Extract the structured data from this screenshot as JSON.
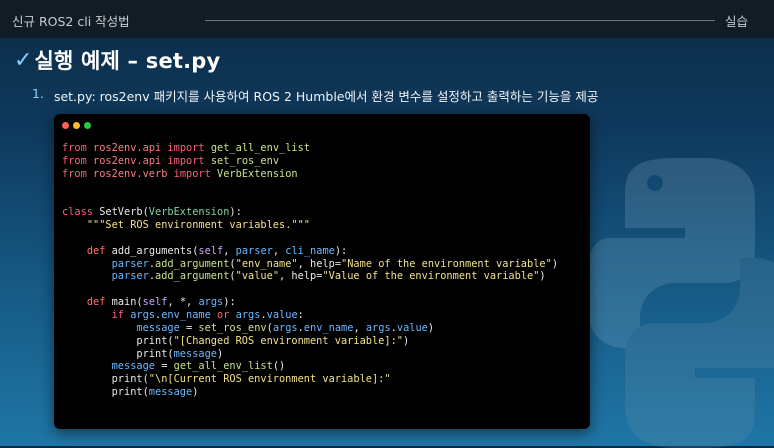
{
  "header": {
    "left_title": "신규 ROS2 cli 작성법",
    "right_tag": "실습"
  },
  "slide": {
    "title": "실행 예제 – set.py",
    "item_number": "1.",
    "item_text": "set.py: ros2env 패키지를 사용하여 ROS 2 Humble에서 환경 변수를 설정하고 출력하는 기능을 제공"
  },
  "code": {
    "lines": [
      [
        [
          "kw",
          "from"
        ],
        [
          "plain",
          " "
        ],
        [
          "mod",
          "ros2env.api"
        ],
        [
          "plain",
          " "
        ],
        [
          "kw",
          "import"
        ],
        [
          "plain",
          " "
        ],
        [
          "fnname",
          "get_all_env_list"
        ]
      ],
      [
        [
          "kw",
          "from"
        ],
        [
          "plain",
          " "
        ],
        [
          "mod",
          "ros2env.api"
        ],
        [
          "plain",
          " "
        ],
        [
          "kw",
          "import"
        ],
        [
          "plain",
          " "
        ],
        [
          "fnname",
          "set_ros_env"
        ]
      ],
      [
        [
          "kw",
          "from"
        ],
        [
          "plain",
          " "
        ],
        [
          "mod",
          "ros2env.verb"
        ],
        [
          "plain",
          " "
        ],
        [
          "kw",
          "import"
        ],
        [
          "plain",
          " "
        ],
        [
          "fnname",
          "VerbExtension"
        ]
      ],
      [
        [
          "plain",
          ""
        ]
      ],
      [
        [
          "plain",
          ""
        ]
      ],
      [
        [
          "kw",
          "class"
        ],
        [
          "plain",
          " SetVerb("
        ],
        [
          "cls",
          "VerbExtension"
        ],
        [
          "plain",
          "):"
        ]
      ],
      [
        [
          "plain",
          "    "
        ],
        [
          "str",
          "\"\"\"Set ROS environment variables.\"\"\""
        ]
      ],
      [
        [
          "plain",
          ""
        ]
      ],
      [
        [
          "plain",
          "    "
        ],
        [
          "def",
          "def"
        ],
        [
          "plain",
          " add_arguments("
        ],
        [
          "self",
          "self"
        ],
        [
          "plain",
          ", "
        ],
        [
          "param",
          "parser"
        ],
        [
          "plain",
          ", "
        ],
        [
          "param",
          "cli_name"
        ],
        [
          "plain",
          "):"
        ]
      ],
      [
        [
          "plain",
          "        "
        ],
        [
          "param",
          "parser"
        ],
        [
          "plain",
          "."
        ],
        [
          "fnname",
          "add_argument"
        ],
        [
          "plain",
          "("
        ],
        [
          "str",
          "\"env_name\""
        ],
        [
          "plain",
          ", help="
        ],
        [
          "str",
          "\"Name of the environment variable\""
        ],
        [
          "plain",
          ")"
        ]
      ],
      [
        [
          "plain",
          "        "
        ],
        [
          "param",
          "parser"
        ],
        [
          "plain",
          "."
        ],
        [
          "fnname",
          "add_argument"
        ],
        [
          "plain",
          "("
        ],
        [
          "str",
          "\"value\""
        ],
        [
          "plain",
          ", help="
        ],
        [
          "str",
          "\"Value of the environment variable\""
        ],
        [
          "plain",
          ")"
        ]
      ],
      [
        [
          "plain",
          ""
        ]
      ],
      [
        [
          "plain",
          "    "
        ],
        [
          "def",
          "def"
        ],
        [
          "plain",
          " main("
        ],
        [
          "self",
          "self"
        ],
        [
          "plain",
          ", *, "
        ],
        [
          "param",
          "args"
        ],
        [
          "plain",
          "):"
        ]
      ],
      [
        [
          "plain",
          "        "
        ],
        [
          "kw",
          "if"
        ],
        [
          "plain",
          " "
        ],
        [
          "param",
          "args"
        ],
        [
          "plain",
          "."
        ],
        [
          "param",
          "env_name"
        ],
        [
          "plain",
          " "
        ],
        [
          "kw",
          "or"
        ],
        [
          "plain",
          " "
        ],
        [
          "param",
          "args"
        ],
        [
          "plain",
          "."
        ],
        [
          "param",
          "value"
        ],
        [
          "plain",
          ":"
        ]
      ],
      [
        [
          "plain",
          "            "
        ],
        [
          "param",
          "message"
        ],
        [
          "plain",
          " = "
        ],
        [
          "fnname",
          "set_ros_env"
        ],
        [
          "plain",
          "("
        ],
        [
          "param",
          "args"
        ],
        [
          "plain",
          "."
        ],
        [
          "param",
          "env_name"
        ],
        [
          "plain",
          ", "
        ],
        [
          "param",
          "args"
        ],
        [
          "plain",
          "."
        ],
        [
          "param",
          "value"
        ],
        [
          "plain",
          ")"
        ]
      ],
      [
        [
          "plain",
          "            print("
        ],
        [
          "str",
          "\"[Changed ROS environment variable]:\""
        ],
        [
          "plain",
          ")"
        ]
      ],
      [
        [
          "plain",
          "            print("
        ],
        [
          "param",
          "message"
        ],
        [
          "plain",
          ")"
        ]
      ],
      [
        [
          "plain",
          "        "
        ],
        [
          "param",
          "message"
        ],
        [
          "plain",
          " = "
        ],
        [
          "fnname",
          "get_all_env_list"
        ],
        [
          "plain",
          "()"
        ]
      ],
      [
        [
          "plain",
          "        print("
        ],
        [
          "str",
          "\"\\n[Current ROS environment variable]:\""
        ]
      ],
      [
        [
          "plain",
          "        print("
        ],
        [
          "param",
          "message"
        ],
        [
          "plain",
          ")"
        ]
      ]
    ]
  },
  "icons": {
    "check": "checkmark-icon",
    "window_controls": [
      "red-dot-icon",
      "yellow-dot-icon",
      "green-dot-icon"
    ],
    "background_logo": "python-logo-icon"
  },
  "colors": {
    "accent": "#7fd1ff",
    "code_bg": "#000000",
    "keyword": "#ff5f7a",
    "string": "#f1e189",
    "function": "#c6e28c",
    "class": "#7fd2a2",
    "param": "#6ab8ff"
  }
}
